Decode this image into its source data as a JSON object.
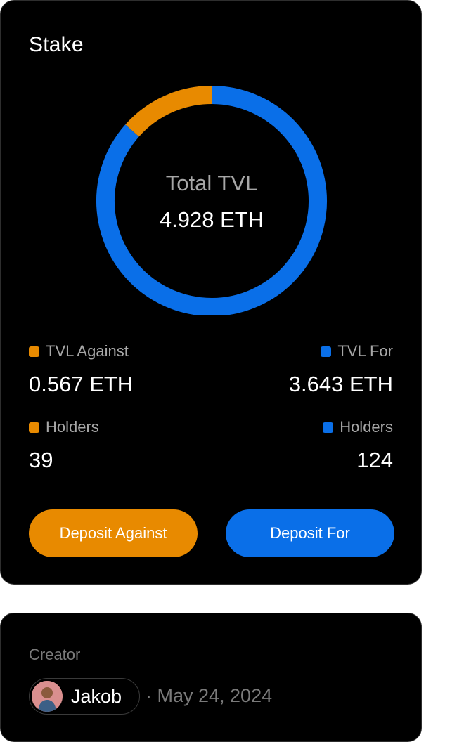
{
  "stake": {
    "title": "Stake",
    "total_label": "Total TVL",
    "total_value": "4.928 ETH",
    "against": {
      "tvl_label": "TVL Against",
      "tvl_value": "0.567 ETH",
      "holders_label": "Holders",
      "holders_value": "39",
      "color": "#e88a00"
    },
    "for": {
      "tvl_label": "TVL For",
      "tvl_value": "3.643 ETH",
      "holders_label": "Holders",
      "holders_value": "124",
      "color": "#0a6fe8"
    },
    "buttons": {
      "deposit_against": "Deposit Against",
      "deposit_for": "Deposit For"
    }
  },
  "chart_data": {
    "type": "pie",
    "categories": [
      "TVL Against",
      "TVL For"
    ],
    "values": [
      0.567,
      3.643
    ],
    "title": "Total TVL",
    "colors": [
      "#e88a00",
      "#0a6fe8"
    ]
  },
  "creator": {
    "label": "Creator",
    "name": "Jakob",
    "date": "· May 24, 2024",
    "avatar_icon": "person-avatar"
  }
}
